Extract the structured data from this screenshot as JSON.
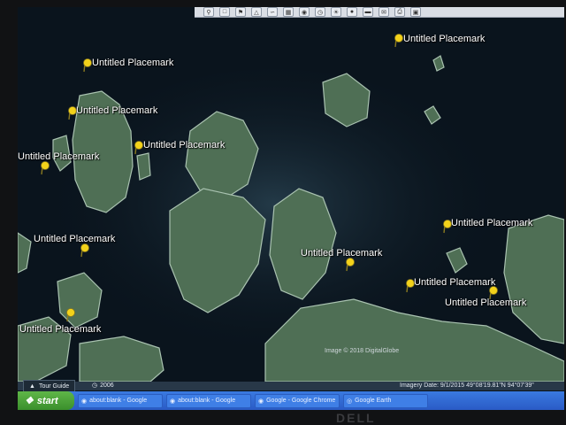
{
  "toolbar": {
    "icons": [
      "zoom-icon",
      "sidebar-icon",
      "placemark-icon",
      "polygon-icon",
      "path-icon",
      "overlay-icon",
      "tour-icon",
      "history-icon",
      "sun-icon",
      "planets-icon",
      "ruler-icon",
      "email-icon",
      "print-icon",
      "view-in-maps-icon"
    ]
  },
  "placemarks": [
    {
      "label": "Untitled Placemark"
    },
    {
      "label": "Untitled Placemark"
    },
    {
      "label": "Untitled Placemark"
    },
    {
      "label": "Untitled Placemark"
    },
    {
      "label": "Untitled Placemark"
    },
    {
      "label": "Untitled Placemark"
    },
    {
      "label": "Untitled Placemark"
    },
    {
      "label": "Untitled Placemark"
    },
    {
      "label": "Untitled Placemark"
    },
    {
      "label": "Untitled Placemark"
    },
    {
      "label": "Untitled Placemark"
    }
  ],
  "map": {
    "copyright": "Image © 2018 DigitalGlobe"
  },
  "statusbar": {
    "tour_guide": "Tour Guide",
    "year": "2006",
    "imagery": "Imagery Date: 9/1/2015    49°08'19.81\"N   94°07'39\""
  },
  "taskbar": {
    "start": "start",
    "tasks": [
      {
        "label": "about:blank - Google"
      },
      {
        "label": "about:blank - Google"
      },
      {
        "label": "Google - Google Chrome"
      },
      {
        "label": "Google Earth"
      }
    ]
  },
  "monitor": {
    "brand": "DELL"
  }
}
